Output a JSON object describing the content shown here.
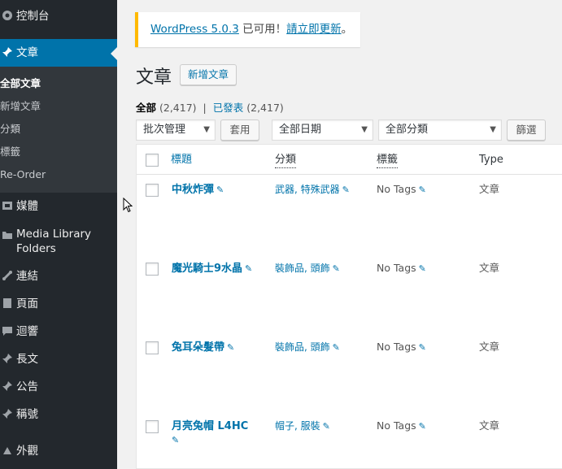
{
  "sidebar": {
    "items": [
      {
        "label": "控制台",
        "icon": "dashboard-icon"
      },
      {
        "label": "文章",
        "icon": "pin-icon"
      },
      {
        "label": "媒體",
        "icon": "media-icon"
      },
      {
        "label": "Media Library",
        "label2": "Folders",
        "icon": "folder-icon"
      },
      {
        "label": "連結",
        "icon": "link-icon"
      },
      {
        "label": "頁面",
        "icon": "page-icon"
      },
      {
        "label": "迴響",
        "icon": "comment-icon"
      },
      {
        "label": "長文",
        "icon": "pin-icon"
      },
      {
        "label": "公告",
        "icon": "pin-icon"
      },
      {
        "label": "稱號",
        "icon": "pin-icon"
      },
      {
        "label": "外觀",
        "icon": "appearance-icon"
      }
    ],
    "submenu": [
      "全部文章",
      "新增文章",
      "分類",
      "標籤",
      "Re-Order"
    ]
  },
  "notice": {
    "link1": "WordPress 5.0.3",
    "text": "已可用！",
    "link2": "請立即更新",
    "end": "。"
  },
  "page": {
    "title": "文章",
    "add_new": "新增文章"
  },
  "views": {
    "all": "全部",
    "all_count": "(2,417)",
    "sep": "|",
    "published": "已發表",
    "published_count": "(2,417)"
  },
  "filters": {
    "bulk": "批次管理",
    "apply": "套用",
    "dates": "全部日期",
    "cats": "全部分類",
    "filter": "篩選"
  },
  "table": {
    "headers": [
      "標題",
      "分類",
      "標籤",
      "Type"
    ],
    "rows": [
      {
        "title": "中秋炸彈",
        "cats": "武器, 特殊武器",
        "tags": "No Tags",
        "type": "文章"
      },
      {
        "title": "魔光騎士9水晶",
        "cats": "裝飾品, 頭飾",
        "tags": "No Tags",
        "type": "文章"
      },
      {
        "title": "兔耳朵髮帶",
        "cats": "裝飾品, 頭飾",
        "tags": "No Tags",
        "type": "文章"
      },
      {
        "title": "月亮兔帽 L4HC",
        "cats": "帽子, 服裝",
        "tags": "No Tags",
        "type": "文章"
      }
    ]
  },
  "colors": {
    "sidebar_bg": "#23282d",
    "submenu_bg": "#32373c",
    "active": "#0073aa",
    "notice_border": "#ffb900",
    "link": "#0073aa"
  }
}
